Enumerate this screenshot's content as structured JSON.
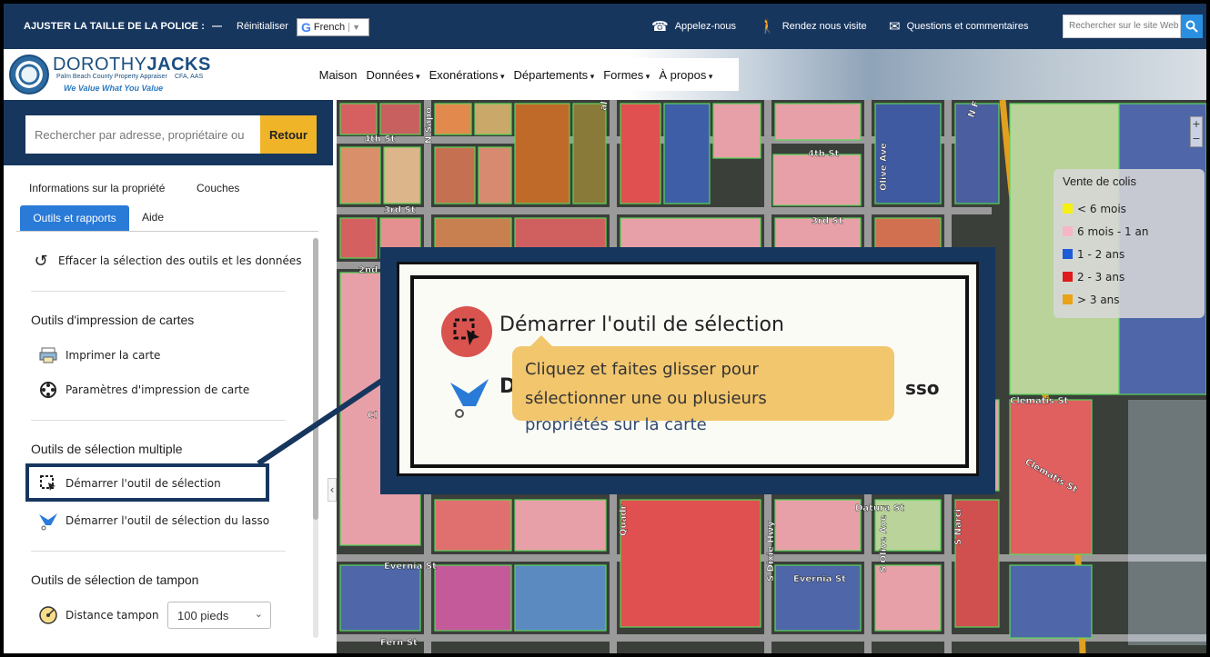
{
  "topbar": {
    "font_size_label": "AJUSTER LA TAILLE DE LA POLICE :",
    "increase_label": "+",
    "decrease_label": "—",
    "reset_label": "Réinitialiser",
    "translate_g": "G",
    "translate_language": "French",
    "translate_arrow": "▼",
    "call_label": "Appelez-nous",
    "visit_label": "Rendez nous visite",
    "feedback_label": "Questions et commentaires",
    "site_search_placeholder": "Rechercher sur le site Web",
    "icons": {
      "call": "phone-icon",
      "visit": "walking-person-icon",
      "feedback": "envelope-icon",
      "search": "search-icon"
    }
  },
  "header": {
    "logo_name_first": "DOROTHY",
    "logo_name_last": "JACKS",
    "logo_credentials": "CFA, AAS",
    "logo_title": "Palm Beach County Property Appraiser",
    "logo_slogan": "We Value What You Value",
    "nav": [
      "Maison",
      "Données",
      "Exonérations",
      "Départements",
      "Formes",
      "À propos"
    ]
  },
  "sidebar": {
    "search_placeholder": "Rechercher par adresse, propriétaire ou",
    "back_label": "Retour",
    "tabs": [
      "Informations sur la propriété",
      "Couches",
      "Outils et rapports",
      "Aide"
    ],
    "clear_label": "Effacer la sélection des outils et les données",
    "print_section": "Outils d'impression de cartes",
    "print_map_label": "Imprimer la carte",
    "print_settings_label": "Paramètres d'impression de carte",
    "multi_section": "Outils de sélection multiple",
    "select_tool_label": "Démarrer l'outil de sélection",
    "lasso_tool_label": "Démarrer l'outil de sélection du lasso",
    "buffer_section": "Outils de sélection de tampon",
    "buffer_label": "Distance tampon",
    "buffer_value": "100 pieds",
    "collapse_glyph": "‹"
  },
  "legend": {
    "title": "Vente de colis",
    "items": [
      {
        "label": "< 6 mois",
        "color": "#f5f010"
      },
      {
        "label": "6 mois - 1 an",
        "color": "#f7b6c4"
      },
      {
        "label": "1 - 2 ans",
        "color": "#1e5bd6"
      },
      {
        "label": "2 - 3 ans",
        "color": "#e01b1b"
      },
      {
        "label": "> 3 ans",
        "color": "#e8a317"
      }
    ]
  },
  "map": {
    "zoom_in": "+",
    "zoom_out": "−",
    "street_labels": [
      "4th St",
      "4th St",
      "3rd St",
      "3rd St",
      "2nd",
      "Cl",
      "Evernia St",
      "Evernia St",
      "Fern St",
      "Clematis St",
      "Clematis St",
      "Olive Ave",
      "S Dixie Hwy",
      "S Olive Ave",
      "N Sapo",
      "N F",
      "Quadr",
      "S Narci",
      "Datura St",
      "al"
    ]
  },
  "callout": {
    "select_label": "Démarrer l'outil de sélection",
    "tooltip_line1": "Cliquez et faites glisser pour",
    "tooltip_line2": "sélectionner une ou plusieurs",
    "tooltip_line3": "propriétés sur la carte",
    "lasso_partial_start": "D",
    "lasso_partial_end": "sso"
  },
  "colors": {
    "navy": "#17365e",
    "accent_blue": "#2a7ad8",
    "button_gold": "#f0b429",
    "tooltip_gold": "#f2c66d",
    "select_red": "#d9534f"
  }
}
